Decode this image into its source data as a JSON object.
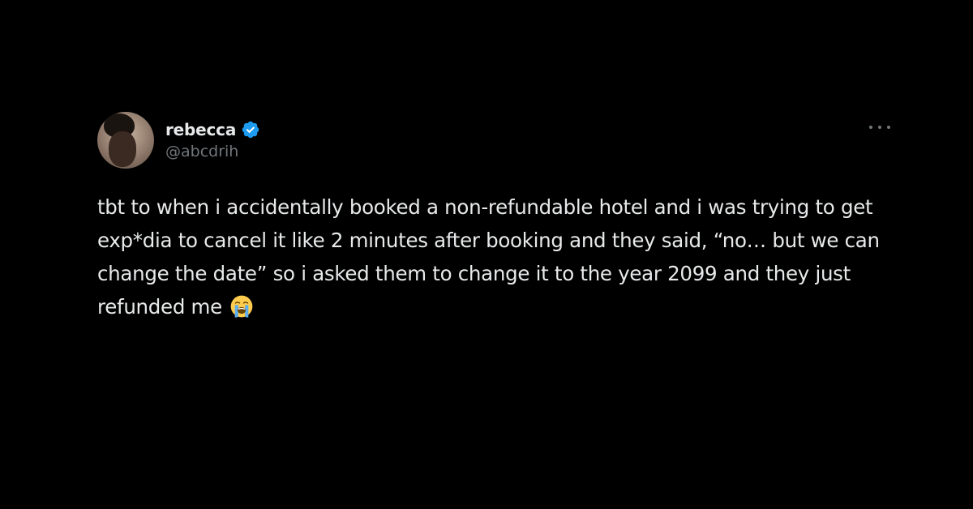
{
  "tweet": {
    "author": {
      "display_name": "rebecca",
      "handle": "@abcdrih",
      "verified": true,
      "avatar_icon": "profile-photo"
    },
    "text": "tbt to when i accidentally booked a non-refundable hotel and i was trying to get exp*dia to cancel it like 2 minutes after booking and they said, “no… but we can change the date” so i asked them to change it to the year 2099 and they just refunded me",
    "trailing_emoji": "loudly-crying-face",
    "more_icon": "more-horizontal-icon"
  },
  "colors": {
    "background": "#000000",
    "primary_text": "#e7e9ea",
    "secondary_text": "#71767b",
    "verified_badge": "#1d9bf0"
  }
}
